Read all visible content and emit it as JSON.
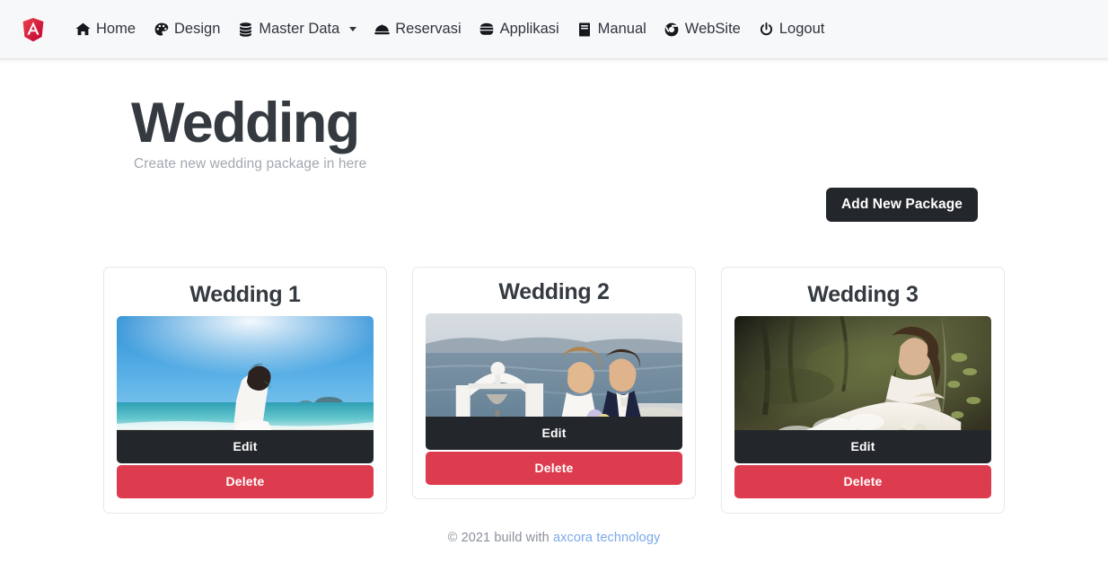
{
  "navbar": {
    "brand_icon": "angular-shield-logo",
    "brand_color": "#dd2c35",
    "items": [
      {
        "label": "Home",
        "icon": "home-icon",
        "has_caret": false
      },
      {
        "label": "Design",
        "icon": "palette-icon",
        "has_caret": false
      },
      {
        "label": "Master Data",
        "icon": "database-icon",
        "has_caret": true
      },
      {
        "label": "Reservasi",
        "icon": "concierge-bell-icon",
        "has_caret": false
      },
      {
        "label": "Applikasi",
        "icon": "hamburger-icon",
        "has_caret": false
      },
      {
        "label": "Manual",
        "icon": "book-icon",
        "has_caret": false
      },
      {
        "label": "WebSite",
        "icon": "chrome-icon",
        "has_caret": false
      },
      {
        "label": "Logout",
        "icon": "power-icon",
        "has_caret": false
      }
    ]
  },
  "header": {
    "title": "Wedding",
    "subtitle": "Create new wedding package in here",
    "add_button_label": "Add New Package"
  },
  "cards": [
    {
      "title": "Wedding 1",
      "image_alt": "beach-wedding-photo",
      "edit_label": "Edit",
      "delete_label": "Delete"
    },
    {
      "title": "Wedding 2",
      "image_alt": "santorini-couple-photo",
      "edit_label": "Edit",
      "delete_label": "Delete"
    },
    {
      "title": "Wedding 3",
      "image_alt": "forest-bride-photo",
      "edit_label": "Edit",
      "delete_label": "Delete"
    }
  ],
  "footer": {
    "text": "© 2021 build with",
    "link_label": "axcora technology",
    "link_color": "#7aa9e9"
  },
  "colors": {
    "navbar_bg": "#f7f8fa",
    "dark_button": "#23272b",
    "delete_button": "#dd3c4e",
    "title": "#343a40",
    "muted": "#a2a8b0"
  }
}
